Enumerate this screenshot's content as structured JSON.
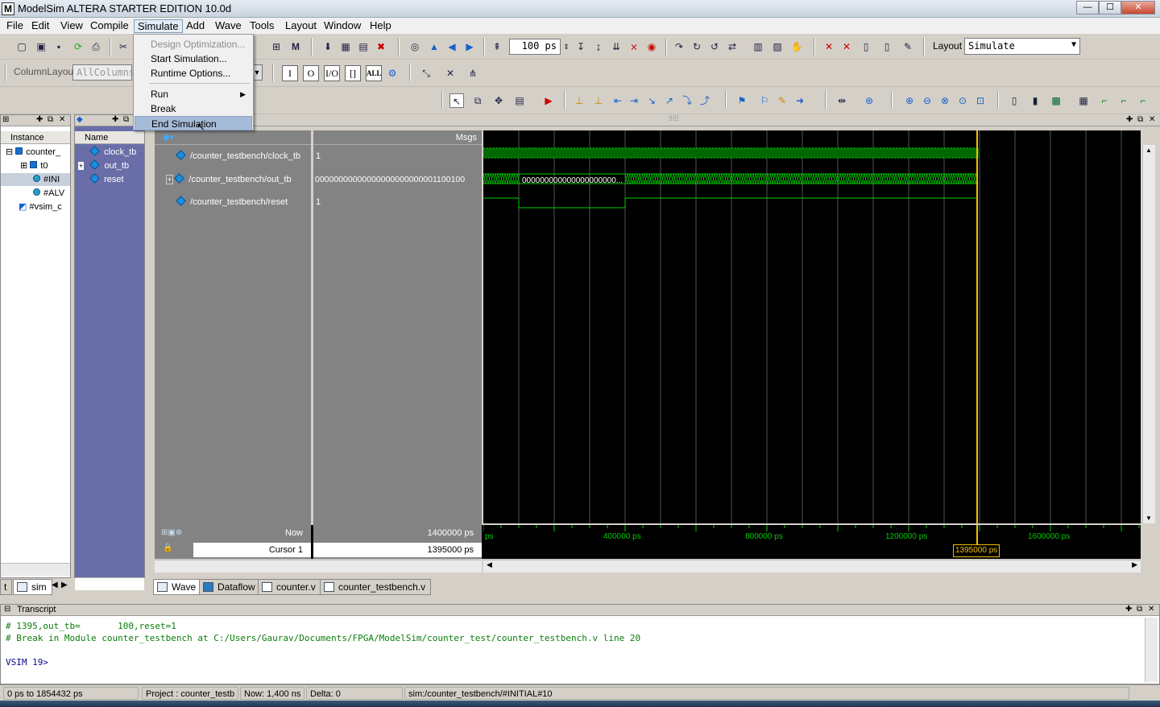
{
  "app": {
    "title": "ModelSim ALTERA STARTER EDITION 10.0d",
    "icon_letter": "M"
  },
  "window_controls": {
    "minimize": "—",
    "maximize": "☐",
    "close": "✕"
  },
  "menubar": [
    "File",
    "Edit",
    "View",
    "Compile",
    "Simulate",
    "Add",
    "Wave",
    "Tools",
    "Layout",
    "Window",
    "Help"
  ],
  "simulate_menu": {
    "items": [
      {
        "label": "Design Optimization...",
        "disabled": true
      },
      {
        "label": "Start Simulation...",
        "disabled": false
      },
      {
        "label": "Runtime Options...",
        "disabled": false
      },
      {
        "label": "Run",
        "submenu": true
      },
      {
        "label": "Break",
        "disabled": false
      },
      {
        "label": "End Simulation",
        "hover": true
      }
    ]
  },
  "toolbar": {
    "run_length": "100 ps",
    "layout_label": "Layout",
    "layout_value": "Simulate",
    "column_layout_label": "ColumnLayout",
    "column_layout_value": "AllColumns",
    "filter_buttons": [
      "I",
      "O",
      "I/O",
      "[]",
      "ALL"
    ]
  },
  "instance_panel": {
    "header": "Instance",
    "rows": [
      "counter_",
      "t0",
      "#INI",
      "#ALV",
      "#vsim_c"
    ]
  },
  "objects_panel": {
    "header": "Name",
    "rows": [
      "clock_tb",
      "out_tb",
      "reset"
    ]
  },
  "wave": {
    "msgs_header": "Msgs",
    "signals": [
      {
        "name": "/counter_testbench/clock_tb",
        "value": "1"
      },
      {
        "name": "/counter_testbench/out_tb",
        "value": "00000000000000000000000001100100"
      },
      {
        "name": "/counter_testbench/reset",
        "value": "1"
      }
    ],
    "bus_label": "000000000000000000000...",
    "now_label": "Now",
    "now_value": "1400000 ps",
    "cursor_label": "Cursor 1",
    "cursor_value": "1395000 ps",
    "cursor_flag": "1395000 ps",
    "timeline": [
      "ps",
      "400000 ps",
      "800000 ps",
      "1200000 ps",
      "1600000 ps"
    ],
    "colors": {
      "signal": "#00d000",
      "cursor": "#f0c000",
      "bg": "#000000"
    }
  },
  "tabs": {
    "left": [
      {
        "label": "t"
      },
      {
        "label": "sim"
      }
    ],
    "main": [
      {
        "label": "Wave"
      },
      {
        "label": "Dataflow"
      },
      {
        "label": "counter.v"
      },
      {
        "label": "counter_testbench.v"
      }
    ]
  },
  "transcript": {
    "title": "Transcript",
    "lines": [
      "# 1395,out_tb=       100,reset=1",
      "# Break in Module counter_testbench at C:/Users/Gaurav/Documents/FPGA/ModelSim/counter_test/counter_testbench.v line 20",
      "",
      "VSIM 19>"
    ]
  },
  "status": {
    "range": "0 ps to 1854432 ps",
    "project": "Project : counter_testb",
    "now": "Now: 1,400 ns",
    "delta": "Delta: 0",
    "context": "sim:/counter_testbench/#INITIAL#10"
  }
}
